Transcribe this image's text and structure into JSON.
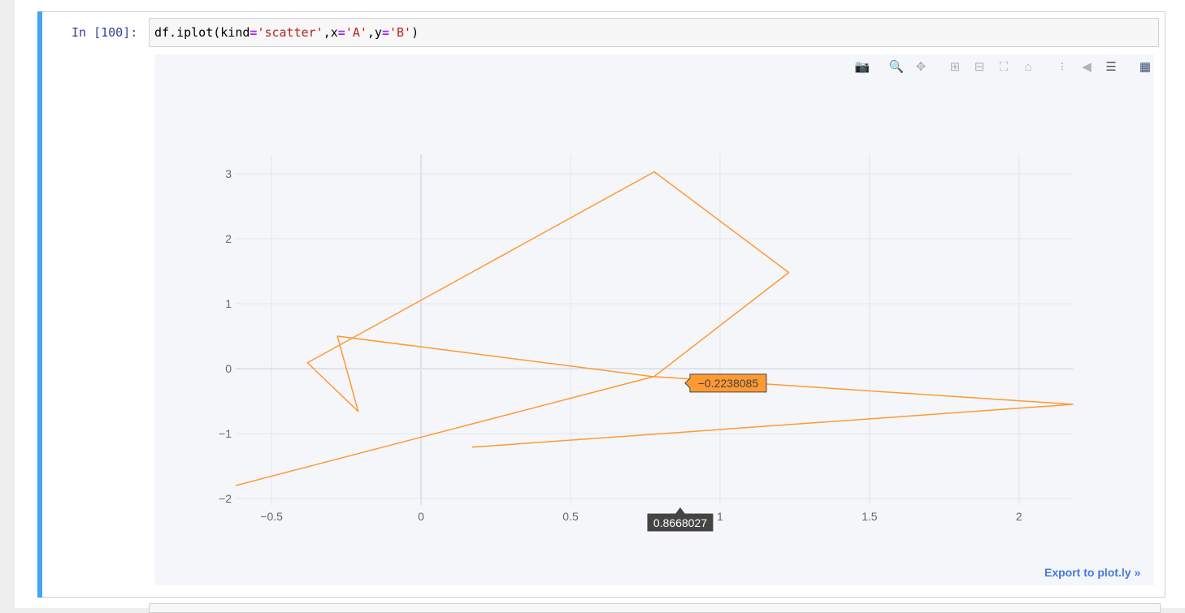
{
  "cell": {
    "prompt": "In [100]:",
    "code": {
      "p1": "df.iplot(kind",
      "op1": "=",
      "s1": "'scatter'",
      "p2": ",x",
      "op2": "=",
      "s2": "'A'",
      "p3": ",y",
      "op3": "=",
      "s3": "'B'",
      "p4": ")"
    }
  },
  "modebar": {
    "icons": [
      "camera-icon",
      "zoom-icon",
      "pan-icon",
      "zoom-in-icon",
      "zoom-out-icon",
      "autoscale-icon",
      "home-icon",
      "spike-lines-icon",
      "hover-closest-icon",
      "hover-compare-icon",
      "plotly-logo-icon"
    ],
    "glyphs": {
      "camera": "📷",
      "zoom": "🔍",
      "pan": "✥",
      "zoom_in": "⊞",
      "zoom_out": "⊟",
      "autoscale": "⛶",
      "home": "⌂",
      "spikes": "⁝",
      "closest": "◀",
      "compare": "☰",
      "logo": "▦"
    }
  },
  "export_link": "Export to plot.ly »",
  "hover": {
    "x_label": "0.8668027",
    "y_label": "−0.2238085"
  },
  "colors": {
    "line": "#ff9933",
    "grid": "#e1e5ed",
    "tick_text": "#666666",
    "hover_x_bg": "#444444"
  },
  "chart_data": {
    "type": "line",
    "title": "",
    "xlabel": "",
    "ylabel": "",
    "xlim": [
      -0.62,
      2.18
    ],
    "ylim": [
      -2.1,
      3.3
    ],
    "xticks": [
      -0.5,
      0,
      0.5,
      1,
      1.5,
      2
    ],
    "xtick_labels": [
      "−0.5",
      "0",
      "0.5",
      "1",
      "1.5",
      "2"
    ],
    "yticks": [
      -2,
      -1,
      0,
      1,
      2,
      3
    ],
    "ytick_labels": [
      "−2",
      "−1",
      "0",
      "1",
      "2",
      "3"
    ],
    "grid": true,
    "series": [
      {
        "x": [
          0.17,
          2.18,
          0.77,
          -0.28,
          -0.21,
          -0.38,
          0.78,
          1.23,
          0.78,
          -0.62
        ],
        "y": [
          -1.21,
          -0.55,
          -0.12,
          0.5,
          -0.66,
          0.09,
          3.03,
          1.48,
          -0.12,
          -1.8
        ]
      }
    ]
  }
}
